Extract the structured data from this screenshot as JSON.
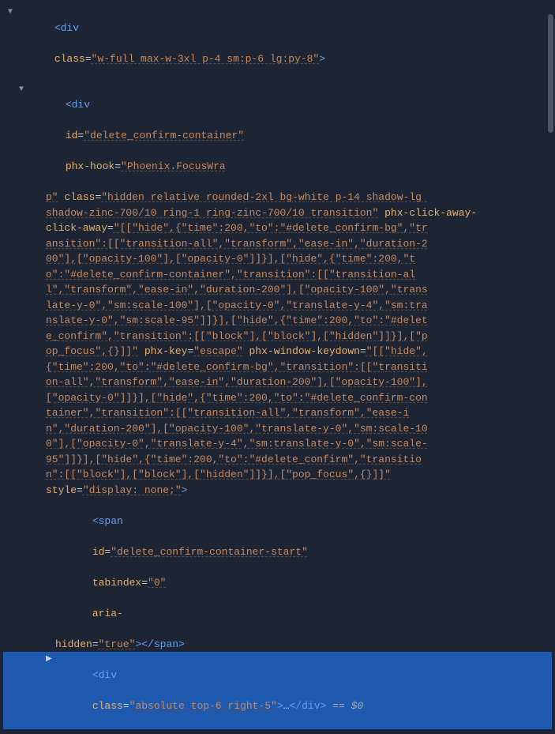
{
  "node0": {
    "tag_open": "<div",
    "class_attr": "class",
    "class_val": "\"w-full max-w-3xl p-4 sm:p-6 lg:py-8\"",
    "close": ">"
  },
  "node1": {
    "tag_open": "<div",
    "id_attr": "id",
    "id_val": "\"delete_confirm-container\"",
    "phx_hook_attr": "phx-hook",
    "phx_hook_val": "\"Phoenix.FocusWra",
    "phx_hook_val2": "p\"",
    "class_attr": "class",
    "class_val": "\"hidden relative rounded-2xl bg-white p-14 shadow-lg ",
    "class_val2": "shadow-zinc-700/10 ring-1 ring-zinc-700/10 transition\"",
    "phx_click_away_attr": "phx-click-away",
    "phx_click_away_val": "\"[[\"hide\",{\"time\":200,\"to\":\"#delete_confirm-bg\",\"tr",
    "cont1": "ansition\":[[\"transition-all\",\"transform\",\"ease-in\",\"duration-2",
    "cont2": "00\"],[\"opacity-100\"],[\"opacity-0\"]]}],[\"hide\",{\"time\":200,\"t",
    "cont3": "o\":\"#delete_confirm-container\",\"transition\":[[\"transition-al",
    "cont4": "l\",\"transform\",\"ease-in\",\"duration-200\"],[\"opacity-100\",\"trans",
    "cont5": "late-y-0\",\"sm:scale-100\"],[\"opacity-0\",\"translate-y-4\",\"sm:tra",
    "cont6": "nslate-y-0\",\"sm:scale-95\"]]}],[\"hide\",{\"time\":200,\"to\":\"#delet",
    "cont7": "e_confirm\",\"transition\":[[\"block\"],[\"block\"],[\"hidden\"]]}],[\"p",
    "cont8": "op_focus\",{}]]\"",
    "phx_key_attr": "phx-key",
    "phx_key_val": "\"escape\"",
    "phx_wkd_attr": "phx-window-keydown",
    "phx_wkd_val": "\"[[\"hide\",",
    "wk1": "{\"time\":200,\"to\":\"#delete_confirm-bg\",\"transition\":[[\"transiti",
    "wk2": "on-all\",\"transform\",\"ease-in\",\"duration-200\"],[\"opacity-100\"],",
    "wk3": "[\"opacity-0\"]]}],[\"hide\",{\"time\":200,\"to\":\"#delete_confirm-con",
    "wk4": "tainer\",\"transition\":[[\"transition-all\",\"transform\",\"ease-i",
    "wk5": "n\",\"duration-200\"],[\"opacity-100\",\"translate-y-0\",\"sm:scale-10",
    "wk6": "0\"],[\"opacity-0\",\"translate-y-4\",\"sm:translate-y-0\",\"sm:scale-",
    "wk7": "95\"]]}],[\"hide\",{\"time\":200,\"to\":\"#delete_confirm\",\"transitio",
    "wk8": "n\":[[\"block\"],[\"block\"],[\"hidden\"]]}],[\"pop_focus\",{}]]\"",
    "style_attr": "style",
    "style_val": "\"display: none;\"",
    "close": ">"
  },
  "node2": {
    "tag_open": "<span",
    "id_attr": "id",
    "id_val": "\"delete_confirm-container-start\"",
    "tab_attr": "tabindex",
    "tab_val": "\"0\"",
    "aria_attr": "aria-",
    "aria2": "hidden",
    "aria_val": "\"true\"",
    "close_tag": "></span>"
  },
  "node3": {
    "tag_open": "<div",
    "class_attr": "class",
    "class_val": "\"absolute top-6 right-5\"",
    "close": ">",
    "ellipsis": "…",
    "end_tag": "</div>",
    "eq": " == ",
    "dollar": "$0"
  }
}
